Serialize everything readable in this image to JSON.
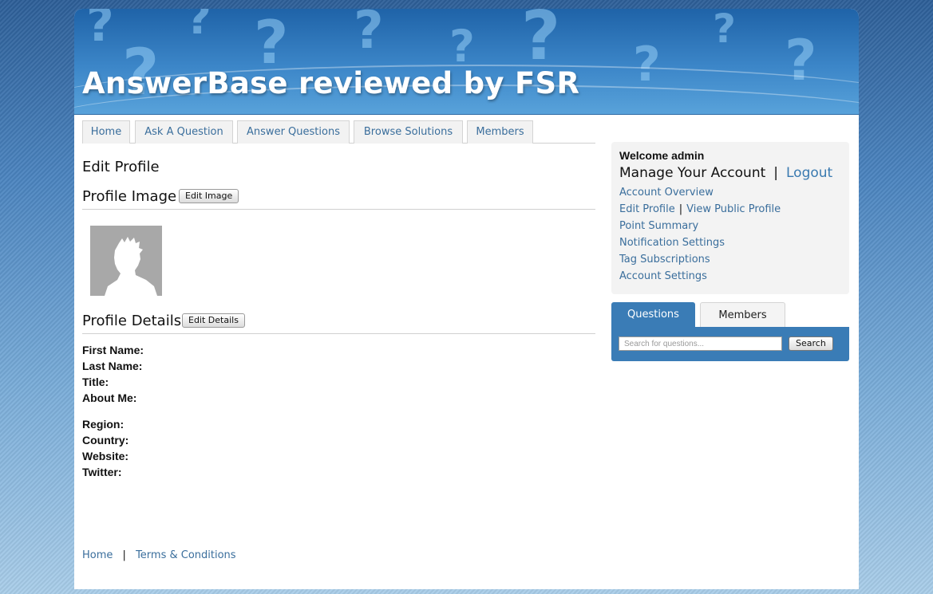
{
  "site": {
    "title": "AnswerBase reviewed by FSR"
  },
  "nav": {
    "tabs": [
      {
        "label": "Home"
      },
      {
        "label": "Ask A Question"
      },
      {
        "label": "Answer Questions"
      },
      {
        "label": "Browse Solutions"
      },
      {
        "label": "Members"
      }
    ]
  },
  "main": {
    "page_title": "Edit Profile",
    "profile_image": {
      "heading": "Profile Image",
      "edit_label": "Edit Image"
    },
    "profile_details": {
      "heading": "Profile Details",
      "edit_label": "Edit Details",
      "fields": [
        {
          "label": "First Name:"
        },
        {
          "label": "Last Name:"
        },
        {
          "label": "Title:"
        },
        {
          "label": "About Me:"
        },
        {
          "label": "Region:"
        },
        {
          "label": "Country:"
        },
        {
          "label": "Website:"
        },
        {
          "label": "Twitter:"
        }
      ]
    }
  },
  "sidebar": {
    "welcome": "Welcome admin",
    "manage_title": "Manage Your Account",
    "separator": "|",
    "logout_label": "Logout",
    "links": {
      "account_overview": "Account Overview",
      "edit_profile": "Edit Profile",
      "view_public_profile": "View Public Profile",
      "point_summary": "Point Summary",
      "notification_settings": "Notification Settings",
      "tag_subscriptions": "Tag Subscriptions",
      "account_settings": "Account Settings"
    },
    "search": {
      "tabs": [
        {
          "label": "Questions",
          "active": true
        },
        {
          "label": "Members",
          "active": false
        }
      ],
      "placeholder": "Search for questions...",
      "button_label": "Search"
    }
  },
  "footer": {
    "home_label": "Home",
    "separator": "|",
    "terms_label": "Terms & Conditions"
  },
  "colors": {
    "link": "#3a6e9c",
    "banner": "#3c86c8",
    "search_panel": "#3a7cb6",
    "sidebar_bg": "#f3f3f3"
  }
}
